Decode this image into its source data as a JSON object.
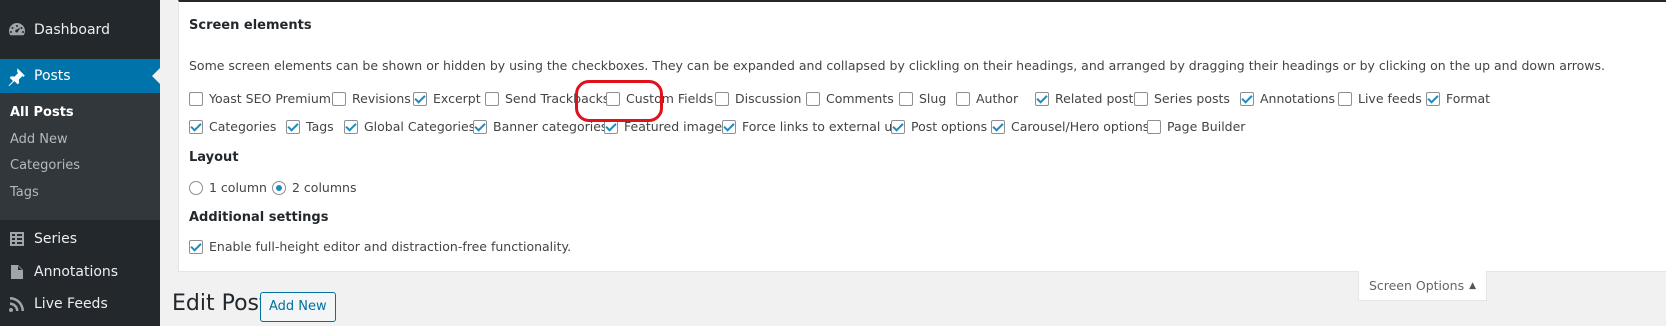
{
  "sidebar": {
    "dashboard": "Dashboard",
    "posts": "Posts",
    "submenu": [
      "All Posts",
      "Add New",
      "Categories",
      "Tags"
    ],
    "series": "Series",
    "annotations": "Annotations",
    "live_feeds": "Live Feeds"
  },
  "screen_options": {
    "elements_legend": "Screen elements",
    "description": "Some screen elements can be shown or hidden by using the checkboxes. They can be expanded and collapsed by clickling on their headings, and arranged by dragging their headings or by clicking on the up and down arrows.",
    "row1": [
      {
        "label": "Yoast SEO Premium",
        "checked": false
      },
      {
        "label": "Revisions",
        "checked": false
      },
      {
        "label": "Excerpt",
        "checked": true
      },
      {
        "label": "Send Trackbacks",
        "checked": false
      },
      {
        "label": "Custom Fields",
        "checked": false
      },
      {
        "label": "Discussion",
        "checked": false
      },
      {
        "label": "Comments",
        "checked": false
      },
      {
        "label": "Slug",
        "checked": false
      },
      {
        "label": "Author",
        "checked": false
      },
      {
        "label": "Related posts",
        "checked": true
      },
      {
        "label": "Series posts",
        "checked": false
      },
      {
        "label": "Annotations",
        "checked": true
      },
      {
        "label": "Live feeds",
        "checked": false
      },
      {
        "label": "Format",
        "checked": true
      }
    ],
    "row2": [
      {
        "label": "Categories",
        "checked": true
      },
      {
        "label": "Tags",
        "checked": true
      },
      {
        "label": "Global Categories",
        "checked": true
      },
      {
        "label": "Banner categories",
        "checked": true
      },
      {
        "label": "Featured image",
        "checked": true
      },
      {
        "label": "Force links to external url",
        "checked": true
      },
      {
        "label": "Post options",
        "checked": true
      },
      {
        "label": "Carousel/Hero options",
        "checked": true
      },
      {
        "label": "Page Builder",
        "checked": false
      }
    ],
    "layout_legend": "Layout",
    "layout_options": [
      {
        "label": "1 column",
        "checked": false
      },
      {
        "label": "2 columns",
        "checked": true
      }
    ],
    "additional_legend": "Additional settings",
    "additional_option": {
      "label": "Enable full-height editor and distraction-free functionality.",
      "checked": true
    },
    "highlight_color": "#e0111b",
    "accent_color": "#0073aa"
  },
  "screen_options_tab": {
    "label": "Screen Options",
    "arrow": "▲"
  },
  "heading": {
    "title": "Edit Post",
    "add_new": "Add New"
  }
}
